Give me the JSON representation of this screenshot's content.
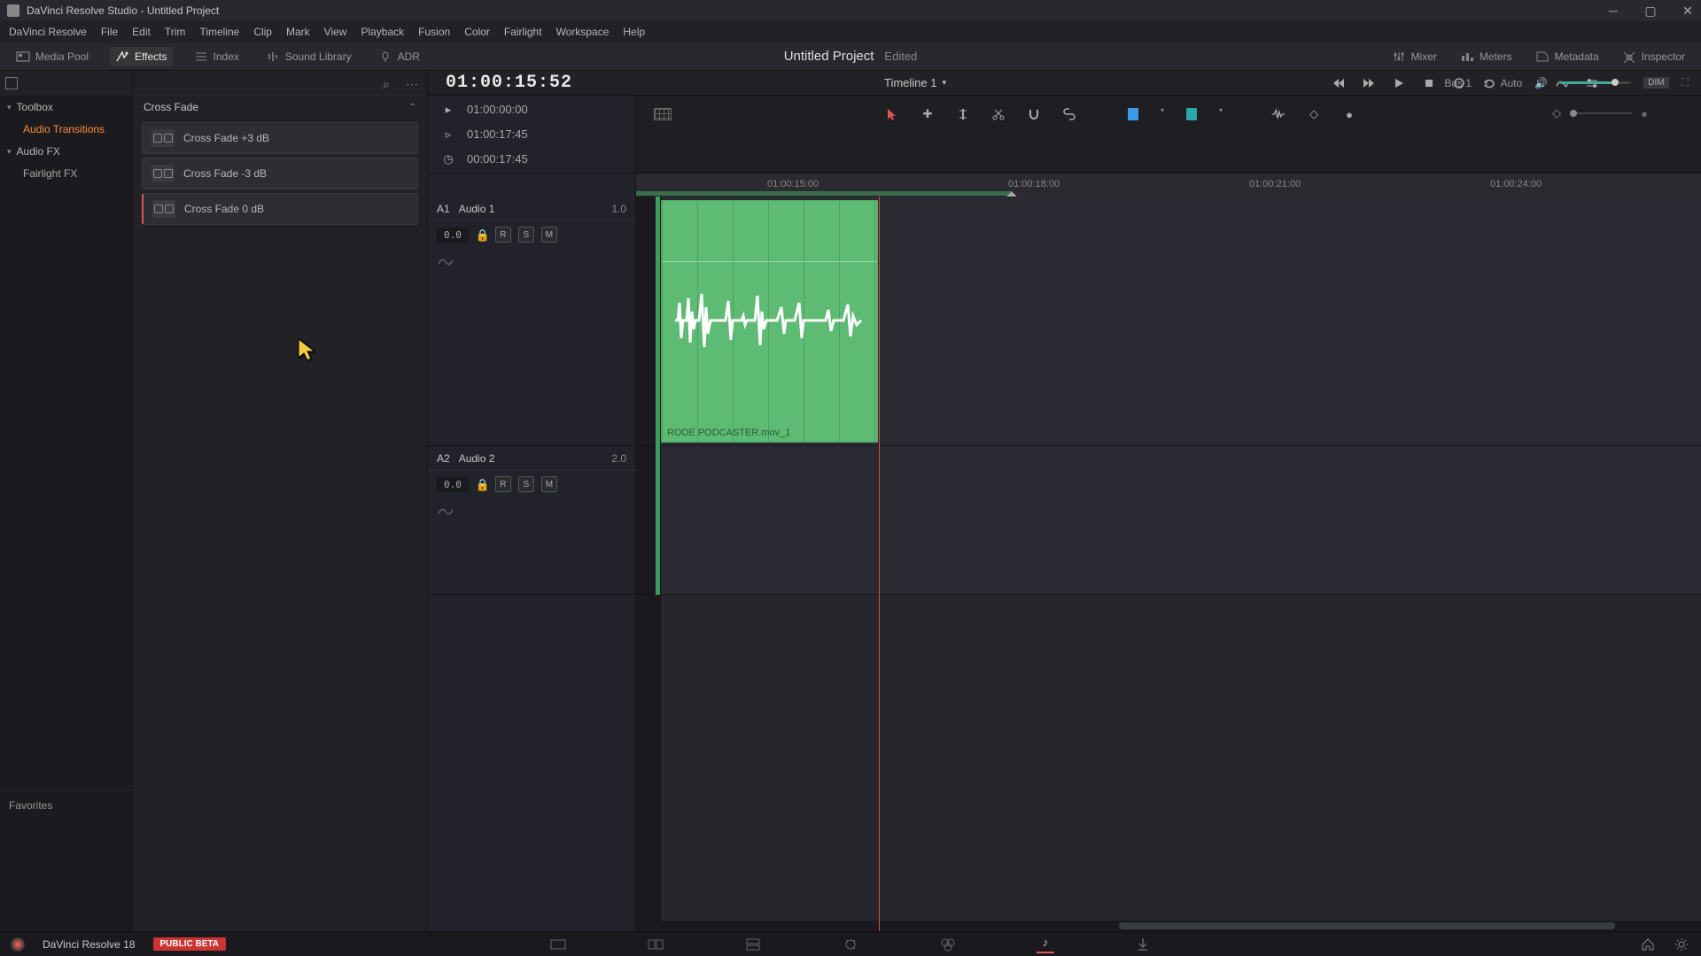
{
  "titlebar": {
    "text": "DaVinci Resolve Studio - Untitled Project"
  },
  "menu": [
    "DaVinci Resolve",
    "File",
    "Edit",
    "Trim",
    "Timeline",
    "Clip",
    "Mark",
    "View",
    "Playback",
    "Fusion",
    "Color",
    "Fairlight",
    "Workspace",
    "Help"
  ],
  "toolbar": {
    "media_pool": "Media Pool",
    "effects": "Effects",
    "index": "Index",
    "sound_library": "Sound Library",
    "adr": "ADR",
    "mixer": "Mixer",
    "meters": "Meters",
    "metadata": "Metadata",
    "inspector": "Inspector"
  },
  "project": {
    "title": "Untitled Project",
    "status": "Edited"
  },
  "sidebar": {
    "toolbox": "Toolbox",
    "audio_transitions": "Audio Transitions",
    "audio_fx": "Audio FX",
    "fairlight_fx": "Fairlight FX",
    "favorites": "Favorites"
  },
  "effects": {
    "header": "Cross Fade",
    "items": [
      "Cross Fade +3 dB",
      "Cross Fade -3 dB",
      "Cross Fade 0 dB"
    ]
  },
  "timeline": {
    "main_tc": "01:00:15:52",
    "name": "Timeline 1",
    "counters": {
      "start": "01:00:00:00",
      "end": "01:00:17:45",
      "dur": "00:00:17:45"
    },
    "ruler": [
      {
        "label": "01:00:15:00",
        "pos": 148
      },
      {
        "label": "01:00:18:00",
        "pos": 420
      },
      {
        "label": "01:00:21:00",
        "pos": 692
      },
      {
        "label": "01:00:24:00",
        "pos": 964
      }
    ],
    "bus": "Bus 1",
    "auto": "Auto",
    "dim": "DIM"
  },
  "tracks": {
    "a1": {
      "id": "A1",
      "name": "Audio 1",
      "ch": "1.0",
      "db": "0.0",
      "r": "R",
      "s": "S",
      "m": "M"
    },
    "a2": {
      "id": "A2",
      "name": "Audio 2",
      "ch": "2.0",
      "db": "0.0",
      "r": "R",
      "s": "S",
      "m": "M"
    }
  },
  "clip": {
    "label": "RODE PODCASTER.mov_1"
  },
  "footer": {
    "app": "DaVinci Resolve 18",
    "beta": "PUBLIC BETA"
  }
}
